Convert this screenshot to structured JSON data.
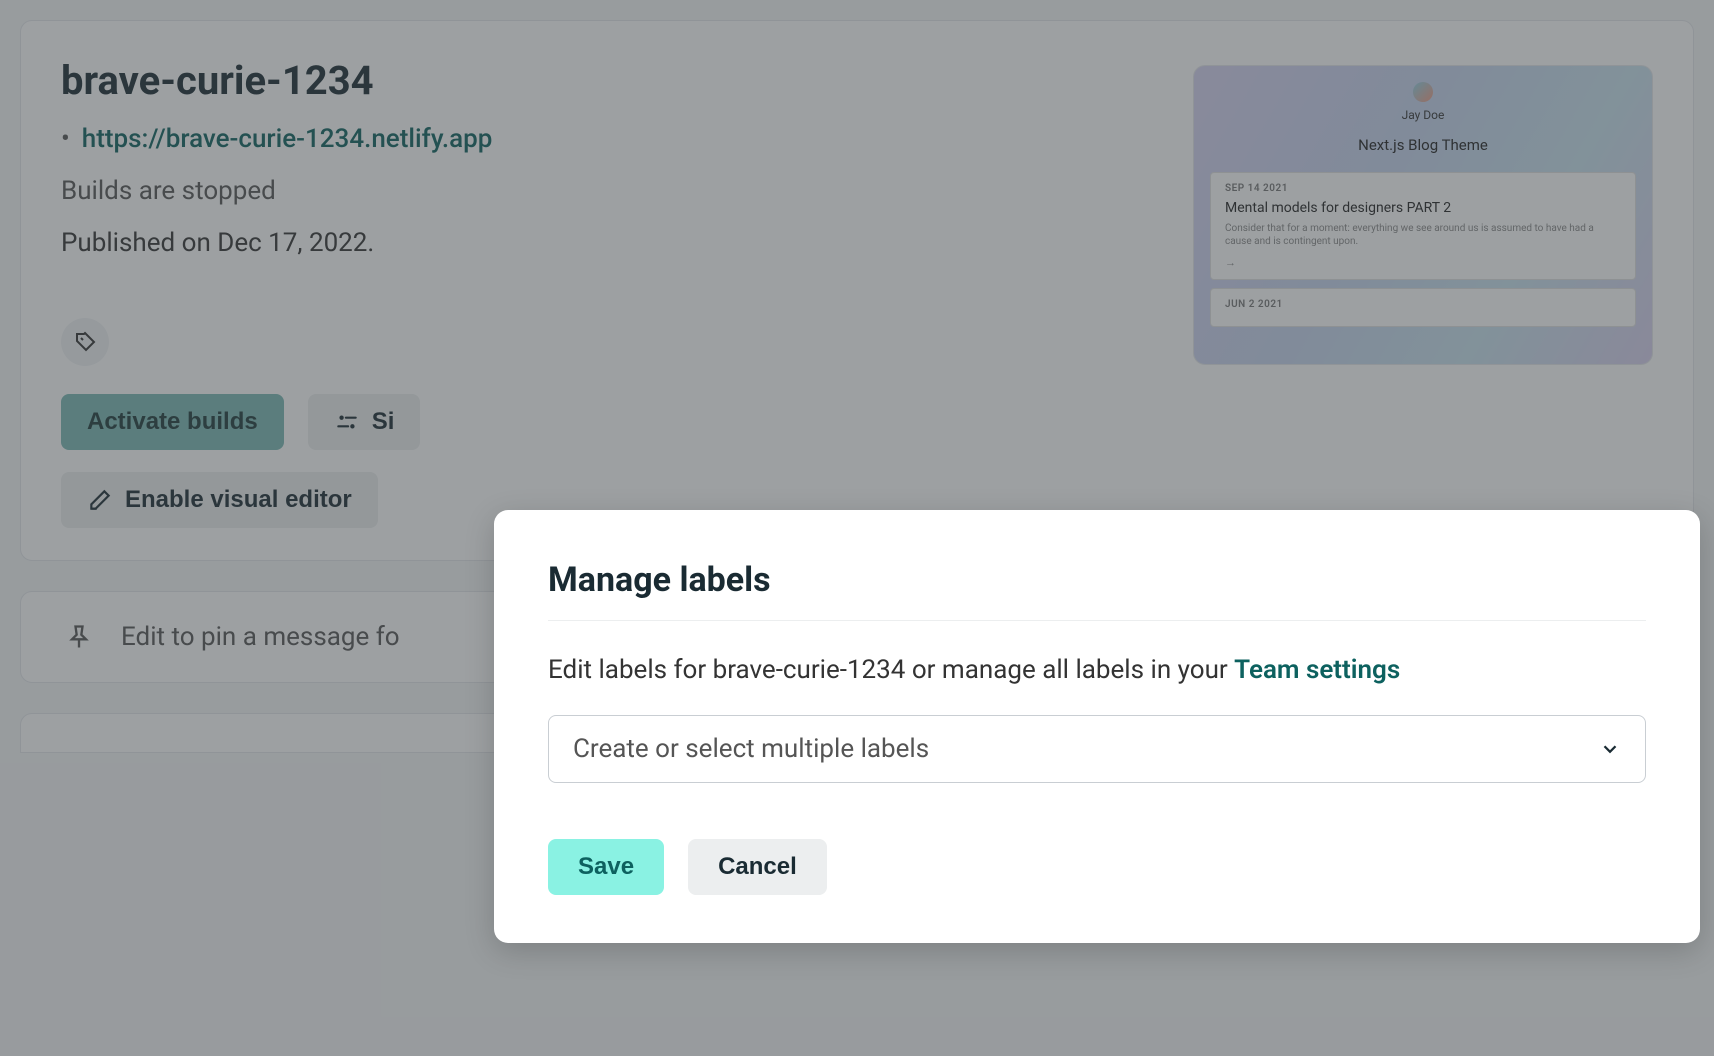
{
  "site": {
    "name": "brave-curie-1234",
    "url": "https://brave-curie-1234.netlify.app",
    "build_status": "Builds are stopped",
    "published": "Published on Dec 17, 2022."
  },
  "buttons": {
    "activate_builds": "Activate builds",
    "site_config_partial": "Si",
    "enable_visual_editor": "Enable visual editor"
  },
  "preview": {
    "author": "Jay Doe",
    "theme": "Next.js Blog Theme",
    "posts": [
      {
        "date": "SEP 14 2021",
        "title": "Mental models for designers PART 2",
        "body": "Consider that for a moment: everything we see around us is assumed to have had a cause and is contingent upon."
      },
      {
        "date": "JUN 2 2021"
      }
    ]
  },
  "pin": {
    "text": "Edit to pin a message fo"
  },
  "modal": {
    "title": "Manage labels",
    "desc_prefix": "Edit labels for brave-curie-1234 or manage all labels in your ",
    "desc_link": "Team settings",
    "select_placeholder": "Create or select multiple labels",
    "save": "Save",
    "cancel": "Cancel"
  }
}
